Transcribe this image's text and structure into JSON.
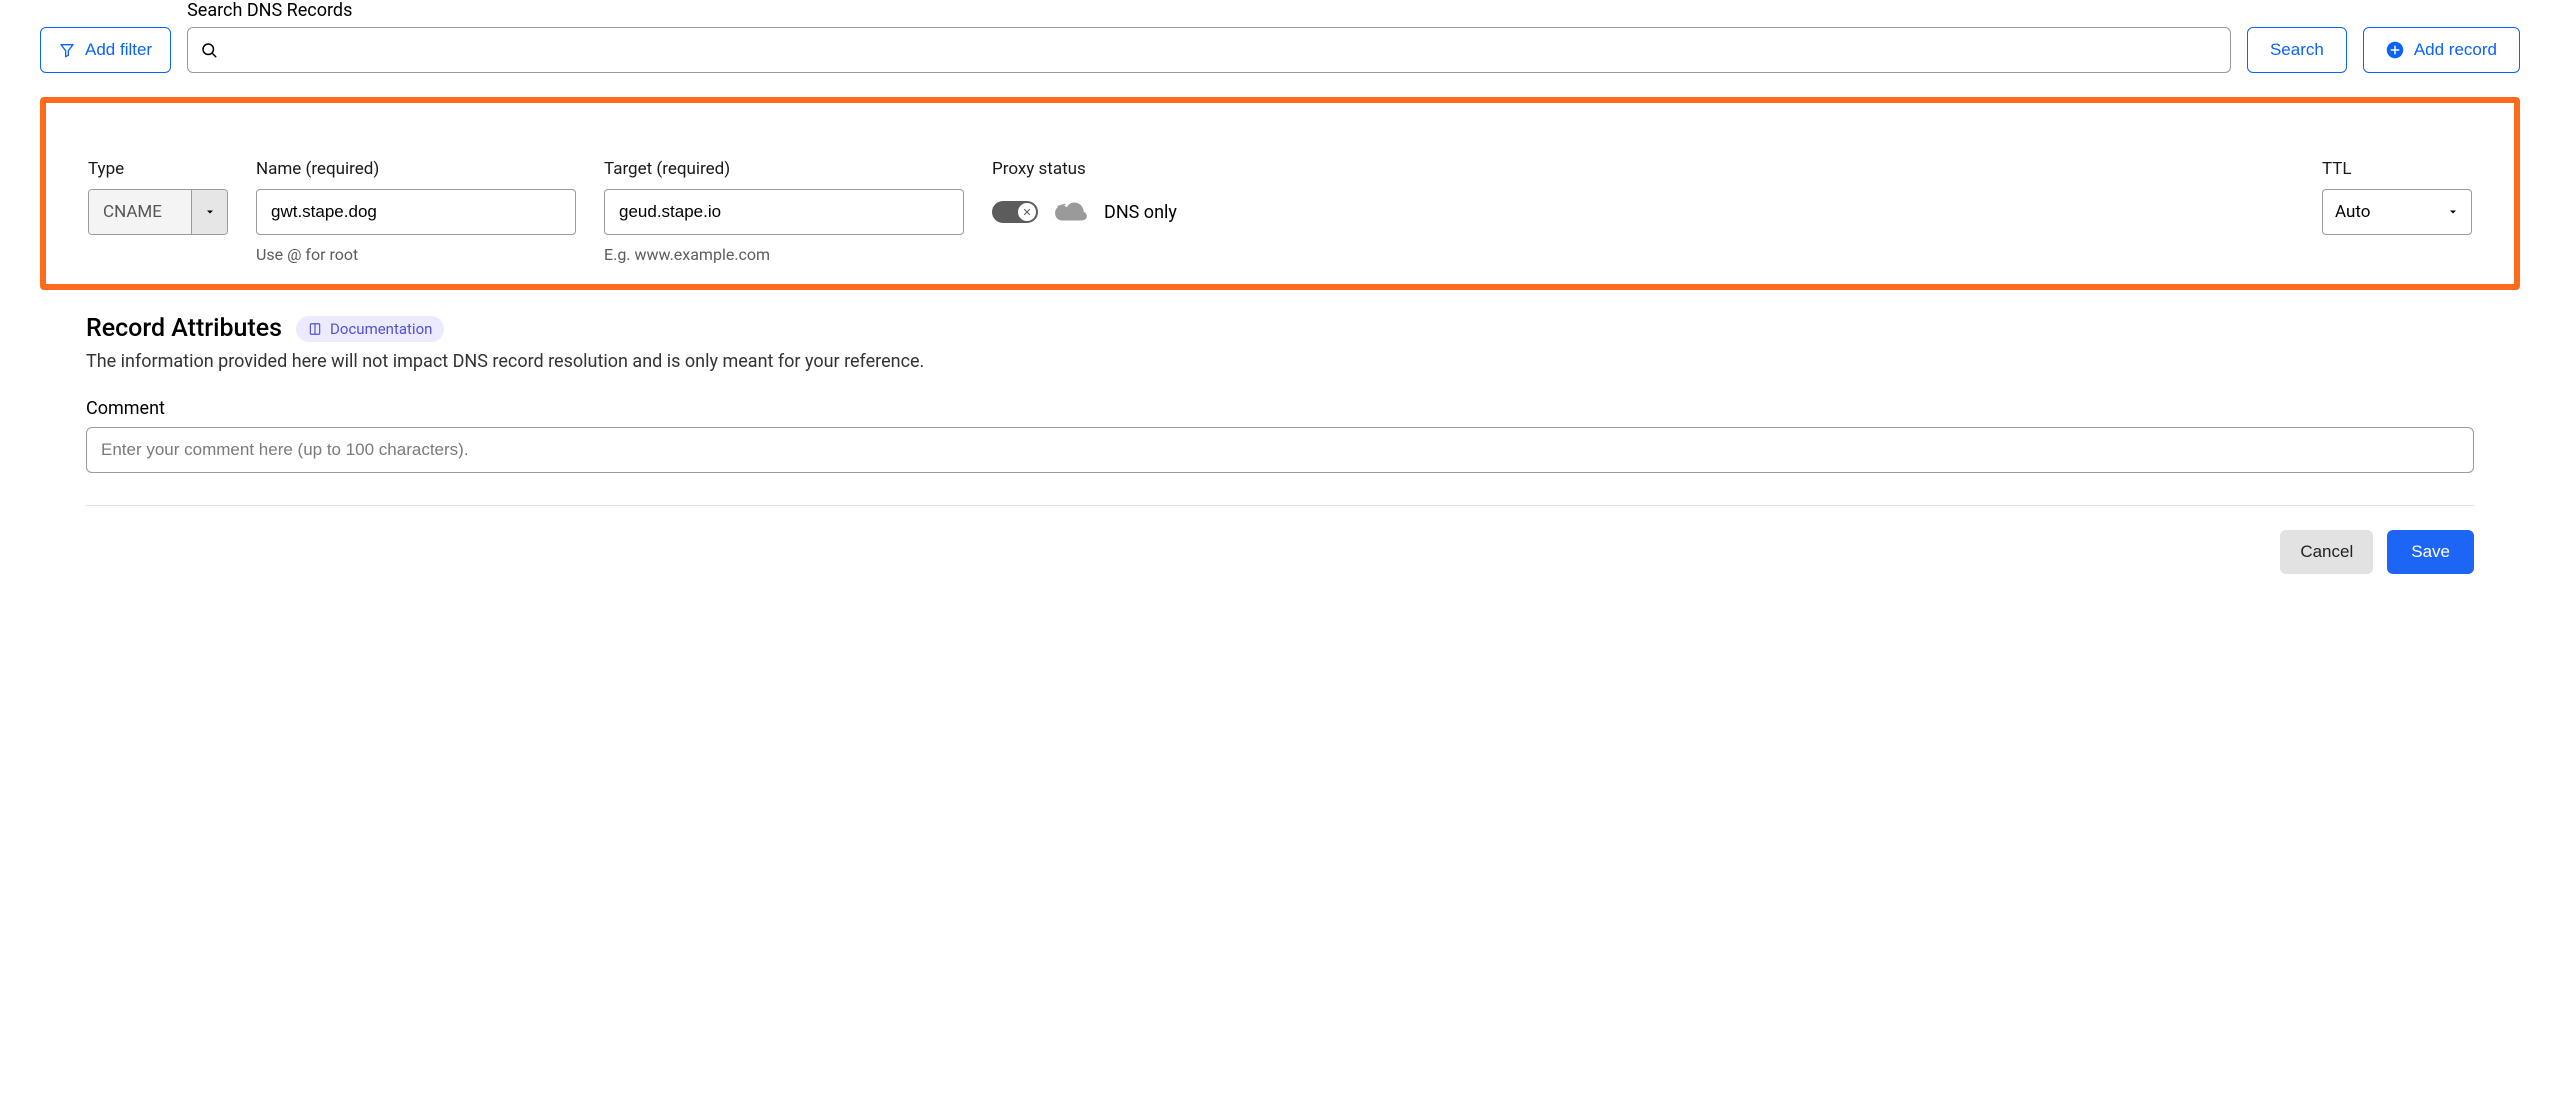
{
  "topbar": {
    "add_filter_label": "Add filter",
    "search_label": "Search DNS Records",
    "search_placeholder": "",
    "search_button": "Search",
    "add_record_label": "Add record"
  },
  "form": {
    "type": {
      "label": "Type",
      "value": "CNAME"
    },
    "name": {
      "label": "Name (required)",
      "value": "gwt.stape.dog",
      "hint": "Use @ for root"
    },
    "target": {
      "label": "Target (required)",
      "value": "geud.stape.io",
      "hint": "E.g. www.example.com"
    },
    "proxy": {
      "label": "Proxy status",
      "value": "DNS only"
    },
    "ttl": {
      "label": "TTL",
      "value": "Auto"
    }
  },
  "attributes": {
    "title": "Record Attributes",
    "doc_label": "Documentation",
    "description": "The information provided here will not impact DNS record resolution and is only meant for your reference.",
    "comment_label": "Comment",
    "comment_placeholder": "Enter your comment here (up to 100 characters)."
  },
  "footer": {
    "cancel": "Cancel",
    "save": "Save"
  }
}
